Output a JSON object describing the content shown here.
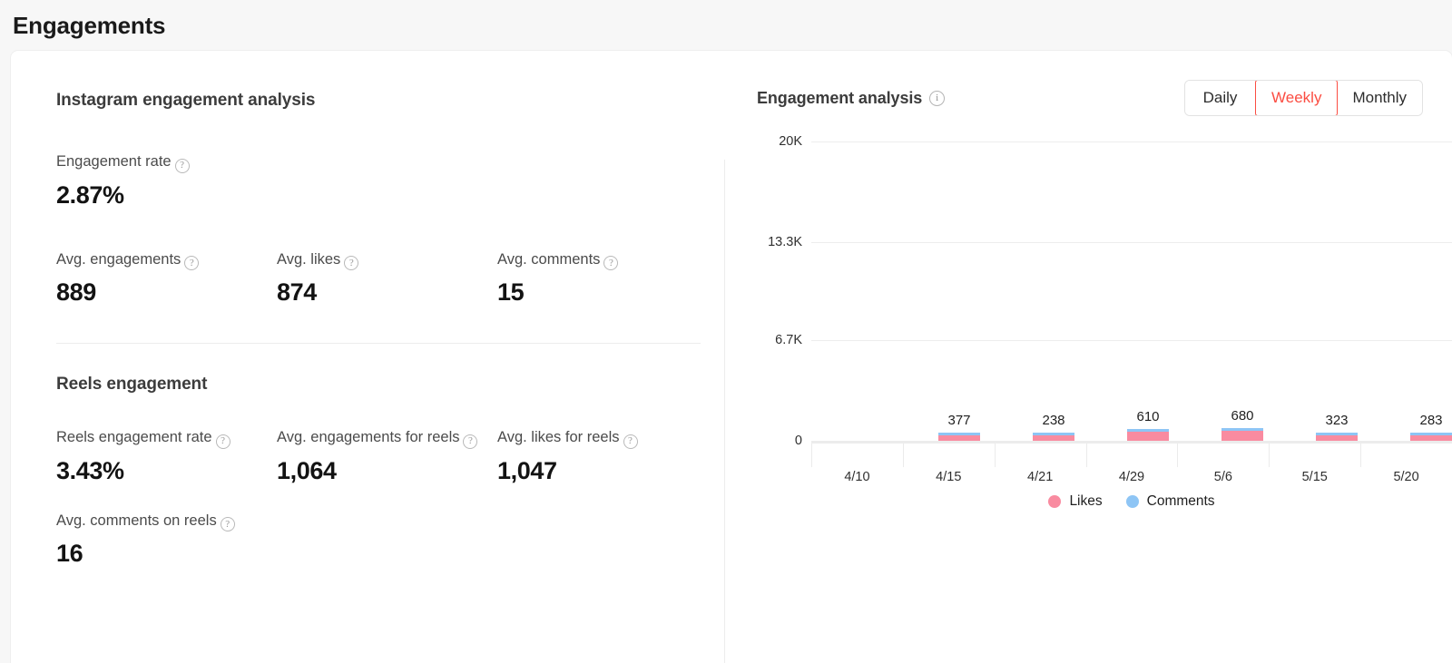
{
  "header": {
    "title": "Engagements"
  },
  "left": {
    "section_title": "Instagram engagement analysis",
    "hero": {
      "label": "Engagement rate",
      "value": "2.87%",
      "help": "?"
    },
    "metrics": [
      {
        "label": "Avg. engagements",
        "value": "889",
        "help": "?"
      },
      {
        "label": "Avg. likes",
        "value": "874",
        "help": "?"
      },
      {
        "label": "Avg. comments",
        "value": "15",
        "help": "?"
      }
    ],
    "reels_title": "Reels engagement",
    "reels_metrics": [
      {
        "label": "Reels engagement rate",
        "value": "3.43%",
        "help": "?"
      },
      {
        "label": "Avg. engagements for reels",
        "value": "1,064",
        "help": "?"
      },
      {
        "label": "Avg. likes for reels",
        "value": "1,047",
        "help": "?"
      }
    ],
    "reels_metrics_row2": [
      {
        "label": "Avg. comments on reels",
        "value": "16",
        "help": "?"
      }
    ]
  },
  "right": {
    "chart_title": "Engagement analysis",
    "info": "i",
    "tabs": [
      {
        "label": "Daily",
        "active": false
      },
      {
        "label": "Weekly",
        "active": true
      },
      {
        "label": "Monthly",
        "active": false
      }
    ],
    "accent_color": "#fb4d42"
  },
  "chart_data": {
    "type": "bar",
    "stacked": true,
    "title": "Engagement analysis",
    "xlabel": "",
    "ylabel": "",
    "ylim": [
      0,
      20000
    ],
    "yticks": [
      0,
      6700,
      13300,
      20000
    ],
    "ytick_labels": [
      "0",
      "6.7K",
      "13.3K",
      "20K"
    ],
    "grid": true,
    "legend_position": "bottom",
    "categories": [
      "4/10",
      "4/15",
      "4/21",
      "4/29",
      "5/6",
      "5/15",
      "5/20"
    ],
    "bar_labels": [
      "",
      "377",
      "238",
      "610",
      "680",
      "323",
      "283"
    ],
    "series": [
      {
        "name": "Likes",
        "color": "#f98ba0",
        "values": [
          null,
          370,
          233,
          598,
          667,
          317,
          278
        ]
      },
      {
        "name": "Comments",
        "color": "#8ec5f5",
        "values": [
          null,
          7,
          5,
          12,
          13,
          6,
          5
        ]
      }
    ],
    "totals": [
      null,
      377,
      238,
      610,
      680,
      323,
      283
    ],
    "note": "last category label 5/20 and its bar are clipped at the right edge of the viewport"
  }
}
